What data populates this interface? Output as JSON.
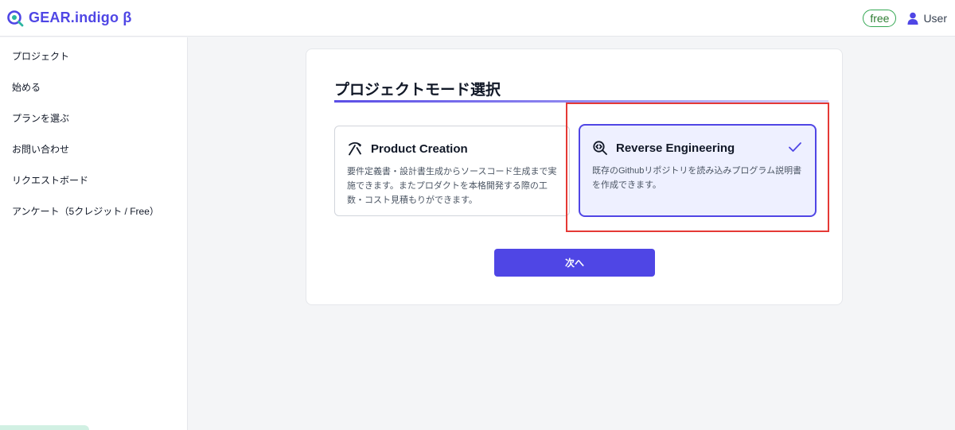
{
  "header": {
    "brand_name": "GEAR.indigo β",
    "plan_badge": "free",
    "user_label": "User"
  },
  "sidebar": {
    "items": [
      {
        "label": "プロジェクト"
      },
      {
        "label": "始める"
      },
      {
        "label": "プランを選ぶ"
      },
      {
        "label": "お問い合わせ"
      },
      {
        "label": "リクエストボード"
      },
      {
        "label": "アンケート（5クレジット / Free）"
      }
    ]
  },
  "main": {
    "title": "プロジェクトモード選択",
    "modes": [
      {
        "title": "Product Creation",
        "description": "要件定義書・設計書生成からソースコード生成まで実施できます。またプロダクトを本格開発する際の工数・コスト見積もりができます。",
        "icon": "pickaxe-icon",
        "selected": false
      },
      {
        "title": "Reverse Engineering",
        "description": "既存のGithubリポジトリを読み込みプログラム説明書を作成できます。",
        "icon": "search-code-icon",
        "selected": true
      }
    ],
    "next_label": "次へ"
  },
  "colors": {
    "accent": "#4f46e5",
    "selected_bg": "#eef0ff",
    "plan_badge": "#34a853",
    "highlight": "#e53935"
  }
}
